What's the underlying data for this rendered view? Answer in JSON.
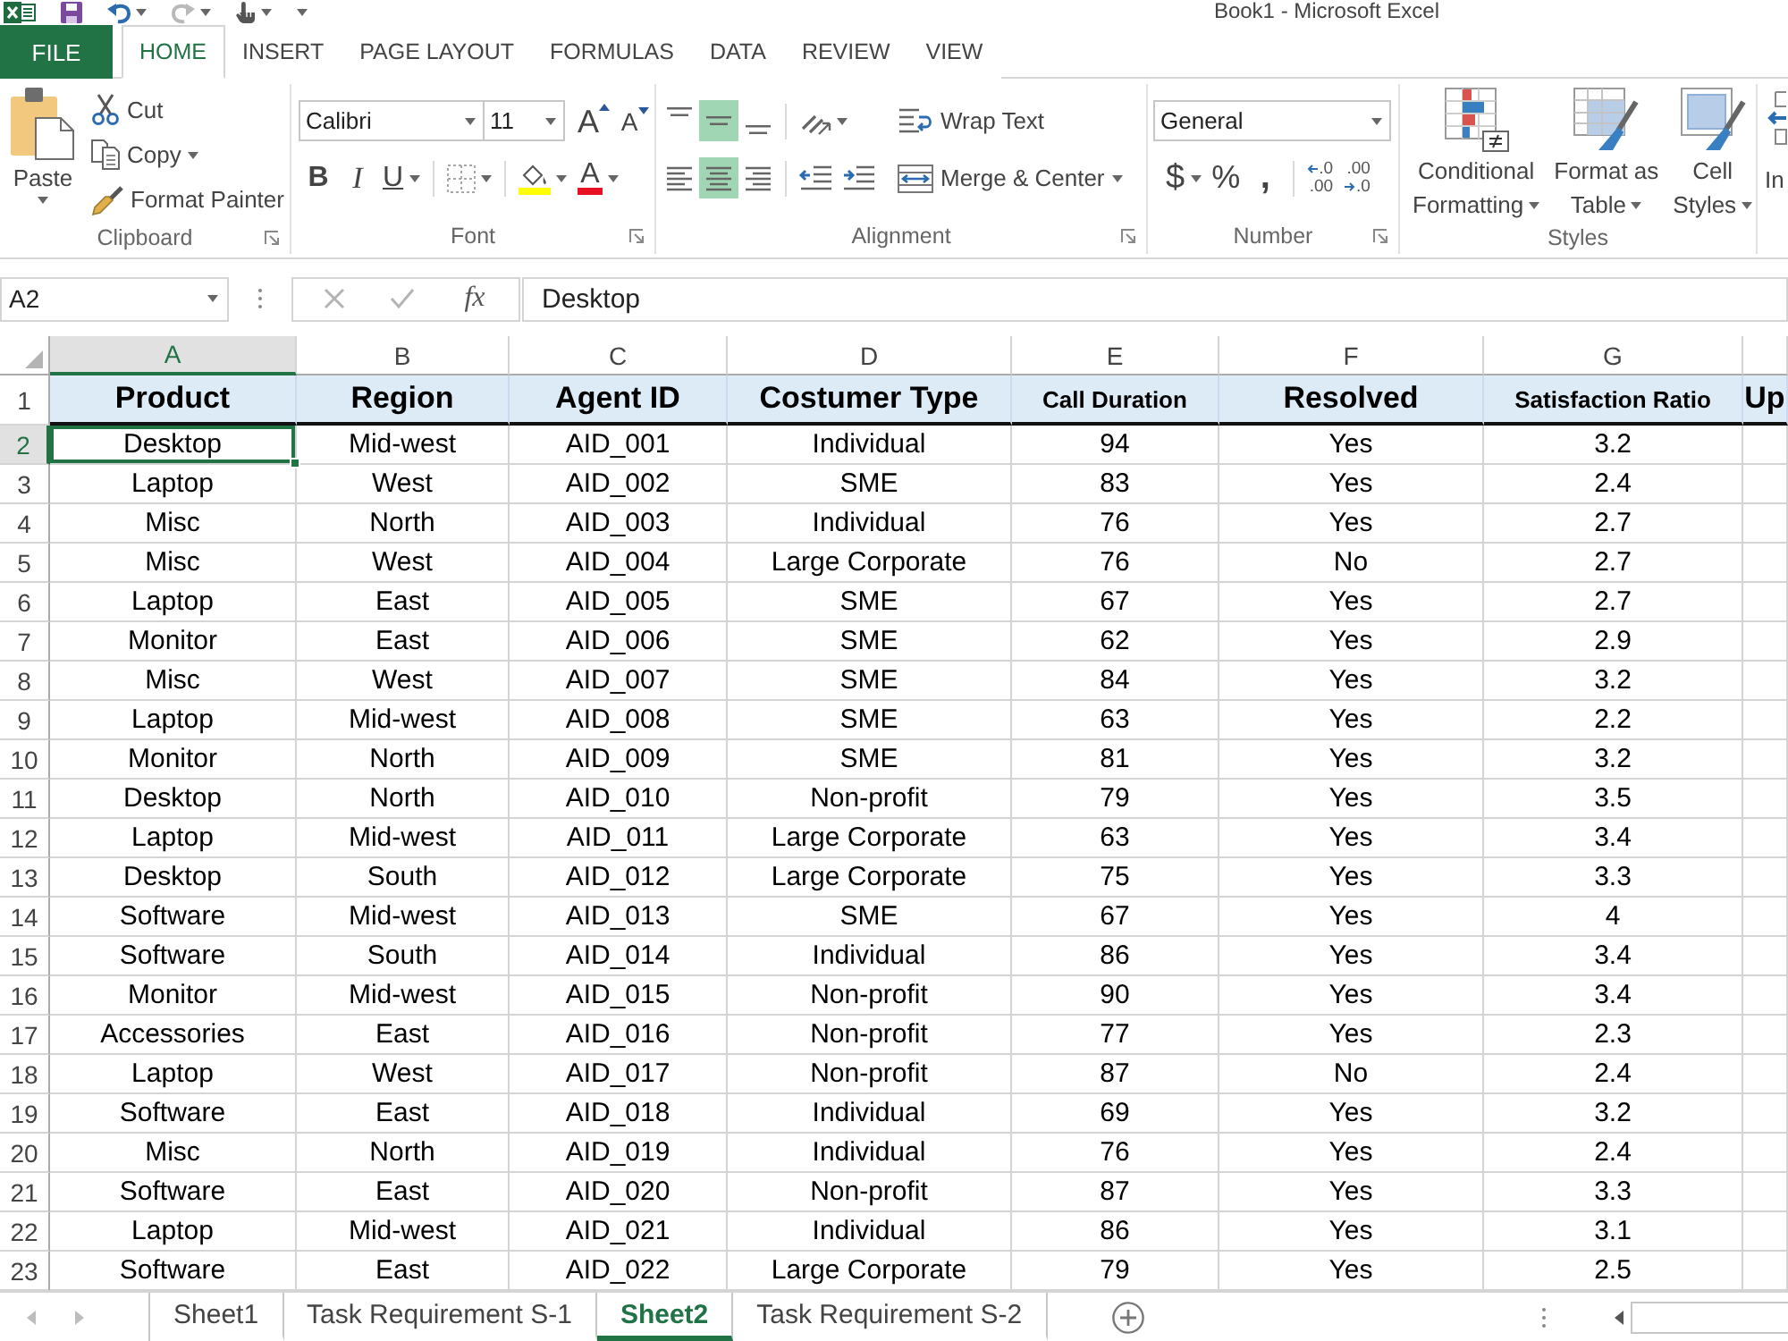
{
  "window": {
    "title": "Book1 - Microsoft Excel"
  },
  "ribbon_tabs": [
    {
      "label": "FILE",
      "kind": "file",
      "selected": false
    },
    {
      "label": "HOME",
      "kind": "tab",
      "selected": true
    },
    {
      "label": "INSERT",
      "kind": "tab",
      "selected": false
    },
    {
      "label": "PAGE LAYOUT",
      "kind": "tab",
      "selected": false
    },
    {
      "label": "FORMULAS",
      "kind": "tab",
      "selected": false
    },
    {
      "label": "DATA",
      "kind": "tab",
      "selected": false
    },
    {
      "label": "REVIEW",
      "kind": "tab",
      "selected": false
    },
    {
      "label": "VIEW",
      "kind": "tab",
      "selected": false
    }
  ],
  "clipboard": {
    "label": "Clipboard",
    "paste": "Paste",
    "cut": "Cut",
    "copy": "Copy",
    "format_painter": "Format Painter"
  },
  "font": {
    "label": "Font",
    "name": "Calibri",
    "size": "11",
    "grow": "A",
    "shrink": "A",
    "bold": "B",
    "italic": "I",
    "underline": "U",
    "font_color": "A"
  },
  "alignment": {
    "label": "Alignment",
    "vertical": [
      {
        "kind": "top",
        "selected": false
      },
      {
        "kind": "middle",
        "selected": true
      },
      {
        "kind": "bottom",
        "selected": false
      }
    ],
    "horizontal": [
      {
        "kind": "left",
        "selected": false
      },
      {
        "kind": "center",
        "selected": true
      },
      {
        "kind": "right",
        "selected": false
      }
    ],
    "wrap_text": "Wrap Text",
    "merge_center": "Merge & Center"
  },
  "number": {
    "label": "Number",
    "format": "General",
    "currency": "$",
    "percent": "%",
    "comma": ",",
    "decimals": [
      {
        "kind": "increase",
        "lines": [
          ".0",
          ".00"
        ]
      },
      {
        "kind": "decrease",
        "lines": [
          ".00",
          ".0"
        ]
      }
    ]
  },
  "styles": {
    "label": "Styles",
    "buttons": [
      {
        "kind": "conditional",
        "lines": [
          "Conditional",
          "Formatting"
        ]
      },
      {
        "kind": "table",
        "lines": [
          "Format as",
          "Table"
        ]
      },
      {
        "kind": "cell",
        "lines": [
          "Cell",
          "Styles"
        ]
      }
    ]
  },
  "cells": {
    "insert": "In"
  },
  "formula_bar": {
    "name_box": "A2",
    "fx": "fx",
    "value": "Desktop"
  },
  "sheet": {
    "header_row": "1",
    "columns": [
      {
        "letter": "A",
        "heading": "Product",
        "kind": "normal",
        "selected": true
      },
      {
        "letter": "B",
        "heading": "Region",
        "kind": "normal",
        "selected": false
      },
      {
        "letter": "C",
        "heading": "Agent ID",
        "kind": "normal",
        "selected": false
      },
      {
        "letter": "D",
        "heading": "Costumer Type",
        "kind": "normal",
        "selected": false
      },
      {
        "letter": "E",
        "heading": "Call Duration",
        "kind": "compact",
        "selected": false
      },
      {
        "letter": "F",
        "heading": "Resolved",
        "kind": "normal",
        "selected": false
      },
      {
        "letter": "G",
        "heading": "Satisfaction Ratio",
        "kind": "compact",
        "selected": false
      },
      {
        "heading": "Up",
        "kind": "normal",
        "selected": false
      }
    ],
    "rows": [
      {
        "number": "2",
        "selected": true,
        "cells": [
          "Desktop",
          "Mid-west",
          "AID_001",
          "Individual",
          "94",
          "Yes",
          "3.2"
        ]
      },
      {
        "number": "3",
        "selected": false,
        "cells": [
          "Laptop",
          "West",
          "AID_002",
          "SME",
          "83",
          "Yes",
          "2.4"
        ]
      },
      {
        "number": "4",
        "selected": false,
        "cells": [
          "Misc",
          "North",
          "AID_003",
          "Individual",
          "76",
          "Yes",
          "2.7"
        ]
      },
      {
        "number": "5",
        "selected": false,
        "cells": [
          "Misc",
          "West",
          "AID_004",
          "Large Corporate",
          "76",
          "No",
          "2.7"
        ]
      },
      {
        "number": "6",
        "selected": false,
        "cells": [
          "Laptop",
          "East",
          "AID_005",
          "SME",
          "67",
          "Yes",
          "2.7"
        ]
      },
      {
        "number": "7",
        "selected": false,
        "cells": [
          "Monitor",
          "East",
          "AID_006",
          "SME",
          "62",
          "Yes",
          "2.9"
        ]
      },
      {
        "number": "8",
        "selected": false,
        "cells": [
          "Misc",
          "West",
          "AID_007",
          "SME",
          "84",
          "Yes",
          "3.2"
        ]
      },
      {
        "number": "9",
        "selected": false,
        "cells": [
          "Laptop",
          "Mid-west",
          "AID_008",
          "SME",
          "63",
          "Yes",
          "2.2"
        ]
      },
      {
        "number": "10",
        "selected": false,
        "cells": [
          "Monitor",
          "North",
          "AID_009",
          "SME",
          "81",
          "Yes",
          "3.2"
        ]
      },
      {
        "number": "11",
        "selected": false,
        "cells": [
          "Desktop",
          "North",
          "AID_010",
          "Non-profit",
          "79",
          "Yes",
          "3.5"
        ]
      },
      {
        "number": "12",
        "selected": false,
        "cells": [
          "Laptop",
          "Mid-west",
          "AID_011",
          "Large Corporate",
          "63",
          "Yes",
          "3.4"
        ]
      },
      {
        "number": "13",
        "selected": false,
        "cells": [
          "Desktop",
          "South",
          "AID_012",
          "Large Corporate",
          "75",
          "Yes",
          "3.3"
        ]
      },
      {
        "number": "14",
        "selected": false,
        "cells": [
          "Software",
          "Mid-west",
          "AID_013",
          "SME",
          "67",
          "Yes",
          "4"
        ]
      },
      {
        "number": "15",
        "selected": false,
        "cells": [
          "Software",
          "South",
          "AID_014",
          "Individual",
          "86",
          "Yes",
          "3.4"
        ]
      },
      {
        "number": "16",
        "selected": false,
        "cells": [
          "Monitor",
          "Mid-west",
          "AID_015",
          "Non-profit",
          "90",
          "Yes",
          "3.4"
        ]
      },
      {
        "number": "17",
        "selected": false,
        "cells": [
          "Accessories",
          "East",
          "AID_016",
          "Non-profit",
          "77",
          "Yes",
          "2.3"
        ]
      },
      {
        "number": "18",
        "selected": false,
        "cells": [
          "Laptop",
          "West",
          "AID_017",
          "Non-profit",
          "87",
          "No",
          "2.4"
        ]
      },
      {
        "number": "19",
        "selected": false,
        "cells": [
          "Software",
          "East",
          "AID_018",
          "Individual",
          "69",
          "Yes",
          "3.2"
        ]
      },
      {
        "number": "20",
        "selected": false,
        "cells": [
          "Misc",
          "North",
          "AID_019",
          "Individual",
          "76",
          "Yes",
          "2.4"
        ]
      },
      {
        "number": "21",
        "selected": false,
        "cells": [
          "Software",
          "East",
          "AID_020",
          "Non-profit",
          "87",
          "Yes",
          "3.3"
        ]
      },
      {
        "number": "22",
        "selected": false,
        "cells": [
          "Laptop",
          "Mid-west",
          "AID_021",
          "Individual",
          "86",
          "Yes",
          "3.1"
        ]
      },
      {
        "number": "23",
        "selected": false,
        "cells": [
          "Software",
          "East",
          "AID_022",
          "Large Corporate",
          "79",
          "Yes",
          "2.5"
        ]
      }
    ]
  },
  "sheet_tabs": [
    {
      "label": "Sheet1",
      "selected": false
    },
    {
      "label": "Task Requirement S-1",
      "selected": false
    },
    {
      "label": "Sheet2",
      "selected": true
    },
    {
      "label": "Task Requirement S-2",
      "selected": false
    }
  ]
}
